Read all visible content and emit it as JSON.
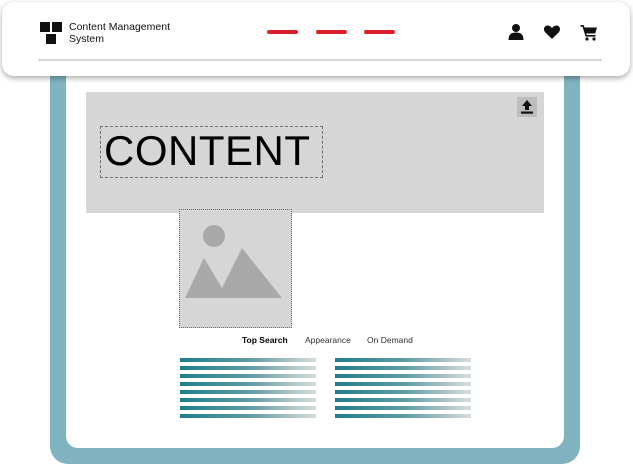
{
  "brand": {
    "line1": "Content Management",
    "line2": "System",
    "logo_icon": "grid-squares-icon"
  },
  "nav": {
    "dashes": [
      {
        "name": "nav-link-1"
      },
      {
        "name": "nav-link-2"
      },
      {
        "name": "nav-link-3"
      }
    ],
    "dash_color": "#d8202a",
    "icons": [
      "user-icon",
      "heart-icon",
      "cart-icon"
    ]
  },
  "hero": {
    "headline": "CONTENT",
    "upload_icon": "upload-icon"
  },
  "tabs": [
    {
      "label": "Top Search",
      "active": true
    },
    {
      "label": "Appearance",
      "active": false
    },
    {
      "label": "On Demand",
      "active": false
    }
  ],
  "colors": {
    "frame": "#7fb3bf",
    "placeholder": "#d6d6d6",
    "accent": "#d8202a",
    "line": "#1f7f8c"
  }
}
